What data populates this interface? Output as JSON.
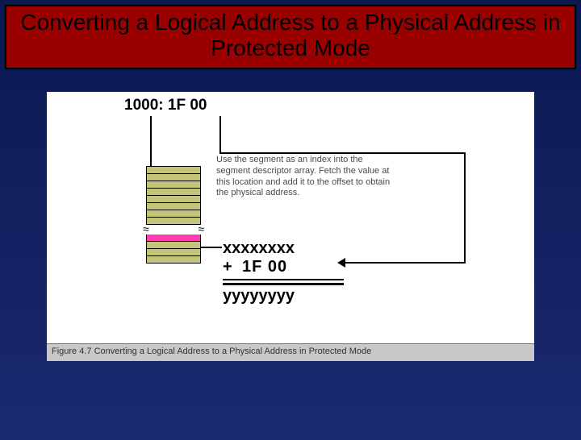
{
  "title": "Converting a Logical Address to a Physical Address in Protected Mode",
  "logical_address": "1000: 1F 00",
  "explain_text": "Use the segment as an index into the segment descriptor array. Fetch the value at this location and add it to the offset to obtain the physical address.",
  "math": {
    "base": "xxxxxxxx",
    "plus": "+",
    "offset": "1F 00",
    "result": "yyyyyyyy"
  },
  "caption": "Figure 4.7 Converting a Logical Address to a Physical Address in Protected Mode"
}
